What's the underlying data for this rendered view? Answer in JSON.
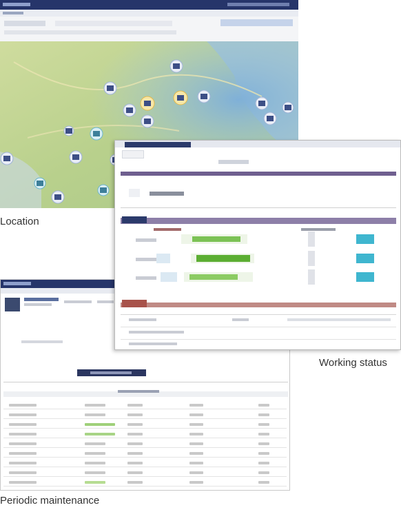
{
  "captions": {
    "location": "Location",
    "working_status": "Working status",
    "periodic_maintenance": "Periodic maintenance"
  },
  "colors": {
    "window_header": "#2b3a6b",
    "map_land": "#b9d08a",
    "map_water": "#8fb8d8",
    "status_green": "#6bbf3f",
    "status_cyan": "#3fb6cf",
    "section_purple": "#6f5f8f",
    "section_red": "#a8524a"
  },
  "screens": {
    "location": {
      "icon_name": "map-marker-icon"
    },
    "working_status": {
      "sections": [
        "status-section",
        "alert-section"
      ]
    },
    "periodic_maintenance": {
      "table_rows": 9
    }
  }
}
